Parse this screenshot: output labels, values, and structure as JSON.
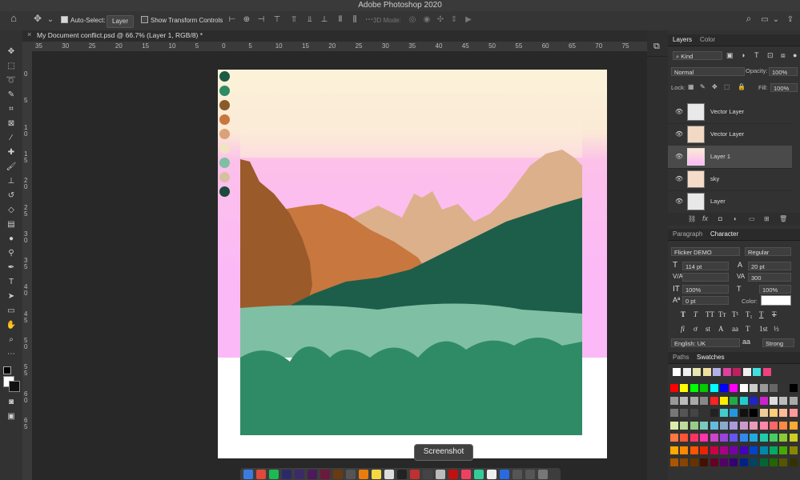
{
  "app": {
    "title": "Adobe Photoshop 2020"
  },
  "options_bar": {
    "auto_select_label": "Auto-Select:",
    "auto_select_value": "Layer",
    "show_transform_label": "Show Transform Controls",
    "mode_3d_label": "3D Mode:"
  },
  "document": {
    "tab_title": "My Document conflict.psd @ 66.7% (Layer 1, RGB/8) *"
  },
  "rulers": {
    "horizontal": [
      "35",
      "30",
      "25",
      "20",
      "15",
      "10",
      "5",
      "0",
      "5",
      "10",
      "15",
      "20",
      "25",
      "30",
      "35",
      "40",
      "45",
      "50",
      "55",
      "60",
      "65",
      "70",
      "75",
      "80"
    ],
    "vertical": [
      "0",
      "5",
      "1 0",
      "1 5",
      "2 0",
      "2 5",
      "3 0",
      "3 5",
      "4 0",
      "4 5",
      "5 0",
      "5 5",
      "6 0",
      "6 5"
    ]
  },
  "layers_panel": {
    "tabs": [
      "Layers",
      "Color"
    ],
    "filter_kind": "Kind",
    "blend_mode": "Normal",
    "opacity_label": "Opacity:",
    "opacity_value": "100%",
    "lock_label": "Lock:",
    "fill_label": "Fill:",
    "fill_value": "100%",
    "layers": [
      {
        "name": "Vector Layer"
      },
      {
        "name": "Vector Layer"
      },
      {
        "name": "Layer 1",
        "selected": true
      },
      {
        "name": "sky"
      },
      {
        "name": "Layer"
      }
    ]
  },
  "character_panel": {
    "tabs": [
      "Paragraph",
      "Character"
    ],
    "font_family": "Flicker DEMO",
    "font_style": "Regular",
    "font_size": "114 pt",
    "leading": "20 pt",
    "tracking": "300",
    "vertical_scale": "100%",
    "horizontal_scale": "100%",
    "baseline_shift": "0 pt",
    "color_label": "Color:",
    "language": "English: UK",
    "aa_label": "a",
    "aa_value": "Strong"
  },
  "swatches_panel": {
    "tabs": [
      "Paths",
      "Swatches"
    ]
  },
  "tooltip": {
    "text": "Screenshot"
  },
  "palette_dots": [
    "#1d5a45",
    "#2e8b64",
    "#8b5a2b",
    "#c8763f",
    "#d9a27a",
    "#f2e3c5",
    "#7fbfa4",
    "#d6c0a1",
    "#1d4a3c"
  ],
  "dock_icons": [
    "Finder",
    "Chrome",
    "Spotify",
    "Ps",
    "Ae",
    "Pr",
    "Id",
    "Ai",
    "Help",
    "Blender",
    "Notes",
    "Files",
    "Terminal",
    "Crossed",
    "Monitor",
    "Bag",
    "Acrobat",
    "Music",
    "Maps",
    "Photos",
    "Dropbox",
    "Help",
    "Help",
    "Trash"
  ]
}
